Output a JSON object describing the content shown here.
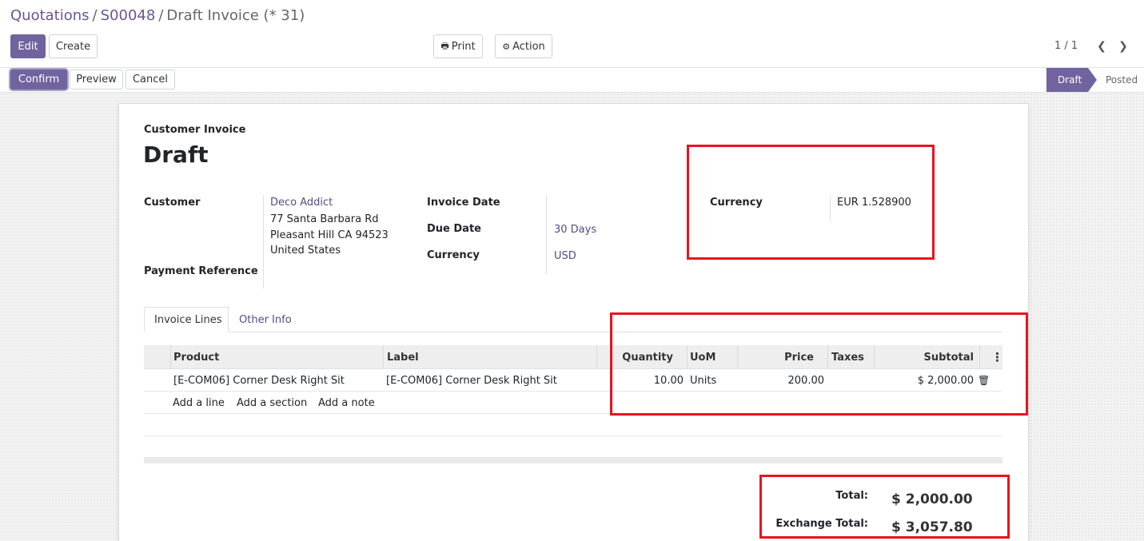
{
  "breadcrumb": {
    "item1": "Quotations",
    "sep": "/",
    "item2": "S00048",
    "current": "Draft Invoice (* 31)"
  },
  "toolbar": {
    "edit": "Edit",
    "create": "Create",
    "print": "Print",
    "action": "Action"
  },
  "pager": {
    "value": "1 / 1"
  },
  "statusbar": {
    "confirm": "Confirm",
    "preview": "Preview",
    "cancel": "Cancel",
    "stages": [
      "Draft",
      "Posted"
    ]
  },
  "invoice": {
    "type": "Customer Invoice",
    "name": "Draft",
    "customer_label": "Customer",
    "customer_name": "Deco Addict",
    "address": [
      "77 Santa Barbara Rd",
      "Pleasant Hill CA 94523",
      "United States"
    ],
    "payment_ref_label": "Payment Reference",
    "invoice_date_label": "Invoice Date",
    "due_date_label": "Due Date",
    "due_date_value": "30 Days",
    "currency_label": "Currency",
    "currency_value": "USD",
    "rate_currency_label": "Currency",
    "rate_currency_value": "EUR 1.528900"
  },
  "tabs": [
    "Invoice Lines",
    "Other Info"
  ],
  "lines": {
    "headers": [
      "Product",
      "Label",
      "Quantity",
      "UoM",
      "Price",
      "Taxes",
      "Subtotal"
    ],
    "rows": [
      {
        "product": "[E-COM06] Corner Desk Right Sit",
        "label": "[E-COM06] Corner Desk Right Sit",
        "quantity": "10.00",
        "uom": "Units",
        "price": "200.00",
        "taxes": "",
        "subtotal": "$ 2,000.00"
      }
    ],
    "add_line": "Add a line",
    "add_section": "Add a section",
    "add_note": "Add a note"
  },
  "totals": {
    "total_label": "Total:",
    "total_value": "$ 2,000.00",
    "exchange_label": "Exchange Total:",
    "exchange_value": "$ 3,057.80"
  },
  "colors": {
    "primary": "#71639e",
    "link": "#584b7f",
    "annotation": "#e8141d"
  }
}
